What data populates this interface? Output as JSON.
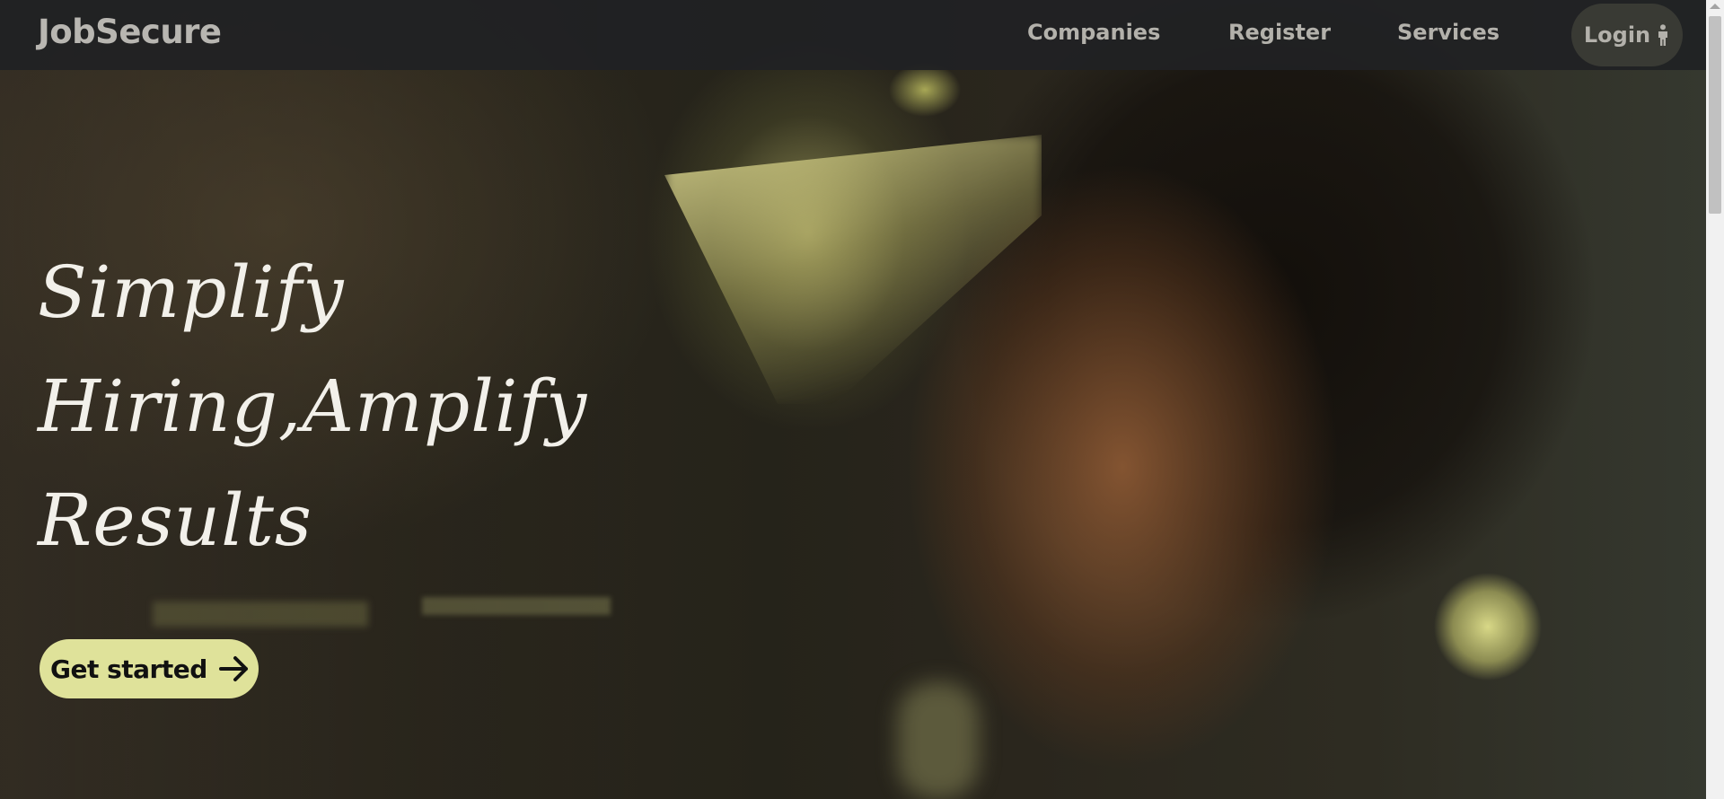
{
  "nav": {
    "brand": "JobSecure",
    "links": [
      "Companies",
      "Register",
      "Services"
    ],
    "login_label": "Login",
    "login_icon": "person-icon"
  },
  "hero": {
    "headline_lines": [
      "Simplify",
      "Hiring,Amplify",
      "Results"
    ],
    "cta_label": "Get started",
    "cta_icon": "arrow-right-icon"
  },
  "colors": {
    "nav_bg": "#202123",
    "nav_text": "#b3b1ab",
    "cta_bg": "#dfe29a",
    "headline": "#f2f0ea"
  }
}
